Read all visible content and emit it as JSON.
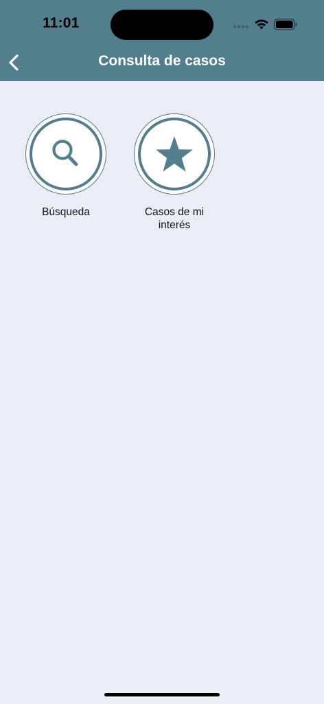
{
  "status_bar": {
    "time": "11:01",
    "icons": [
      "cellular-dots-icon",
      "wifi-icon",
      "battery-icon"
    ]
  },
  "header": {
    "title": "Consulta de casos",
    "back_icon": "chevron-left-icon"
  },
  "tiles": [
    {
      "label": "Búsqueda",
      "icon": "search-icon"
    },
    {
      "label": "Casos de mi interés",
      "icon": "star-icon"
    }
  ],
  "colors": {
    "header_bg": "#527e8e",
    "accent": "#527e8e",
    "page_bg": "#eaedf5",
    "title_text": "#ffffff"
  }
}
